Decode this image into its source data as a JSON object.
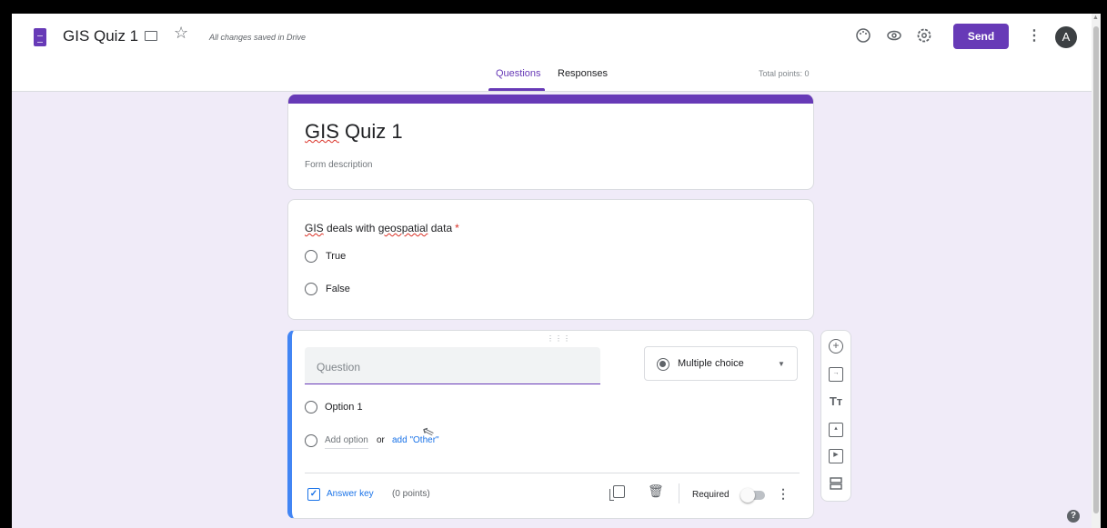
{
  "header": {
    "title": "GIS Quiz 1",
    "save_status": "All changes saved in Drive",
    "send_label": "Send",
    "avatar_letter": "A",
    "icons": [
      "document-icon",
      "folder-icon",
      "star-icon",
      "palette-icon",
      "preview-eye-icon",
      "settings-icon",
      "more-vert-icon"
    ]
  },
  "tabs": [
    {
      "label": "Questions",
      "active": true
    },
    {
      "label": "Responses",
      "active": false
    }
  ],
  "total_points": "Total points: 0",
  "form": {
    "title": "GIS Quiz 1",
    "description_placeholder": "Form description",
    "accent_color": "#673ab7"
  },
  "question1": {
    "text_parts": [
      "GIS",
      " deals with ",
      "geospatial",
      " data"
    ],
    "required_mark": "*",
    "options": [
      "True",
      "False"
    ]
  },
  "question2": {
    "placeholder": "Question",
    "type": "Multiple choice",
    "options": [
      "Option 1"
    ],
    "add_option": "Add option",
    "or": "or",
    "add_other": "add \"Other\"",
    "answer_key": "Answer key",
    "points": "(0 points)",
    "required_label": "Required",
    "required": false
  },
  "side_toolbar": [
    "add-question-icon",
    "import-questions-icon",
    "add-title-icon",
    "add-image-icon",
    "add-video-icon",
    "add-section-icon"
  ]
}
